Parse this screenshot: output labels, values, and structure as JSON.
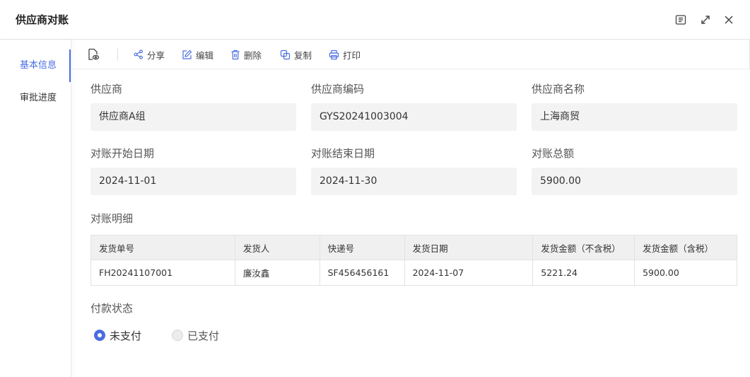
{
  "window": {
    "title": "供应商对账"
  },
  "header_buttons": [
    {
      "icon": "document-icon"
    },
    {
      "icon": "expand-icon"
    },
    {
      "icon": "close-icon"
    }
  ],
  "sidebar": {
    "items": [
      {
        "label": "基本信息",
        "active": true
      },
      {
        "label": "审批进度",
        "active": false
      }
    ]
  },
  "toolbar": {
    "view_icon": "view-file-icon",
    "items": [
      {
        "label": "分享",
        "icon": "share-icon"
      },
      {
        "label": "编辑",
        "icon": "edit-icon"
      },
      {
        "label": "删除",
        "icon": "trash-icon"
      },
      {
        "label": "复制",
        "icon": "copy-icon"
      },
      {
        "label": "打印",
        "icon": "print-icon"
      }
    ]
  },
  "fields": {
    "supplier": {
      "label": "供应商",
      "value": "供应商A组"
    },
    "supplier_code": {
      "label": "供应商编码",
      "value": "GYS20241003004"
    },
    "supplier_name": {
      "label": "供应商名称",
      "value": "上海商贸"
    },
    "start_date": {
      "label": "对账开始日期",
      "value": "2024-11-01"
    },
    "end_date": {
      "label": "对账结束日期",
      "value": "2024-11-30"
    },
    "total": {
      "label": "对账总额",
      "value": "5900.00"
    }
  },
  "detail": {
    "label": "对账明细",
    "columns": [
      "发货单号",
      "发货人",
      "快递号",
      "发货日期",
      "发货金额（不含税）",
      "发货金额（含税）"
    ],
    "rows": [
      [
        "FH20241107001",
        "廉汝鑫",
        "SF456456161",
        "2024-11-07",
        "5221.24",
        "5900.00"
      ]
    ]
  },
  "payment": {
    "label": "付款状态",
    "options": [
      {
        "label": "未支付",
        "checked": true
      },
      {
        "label": "已支付",
        "checked": false
      }
    ]
  },
  "colors": {
    "accent": "#4a6ee0",
    "field_bg": "#f3f3f3",
    "table_header_bg": "#f0f0f0"
  }
}
